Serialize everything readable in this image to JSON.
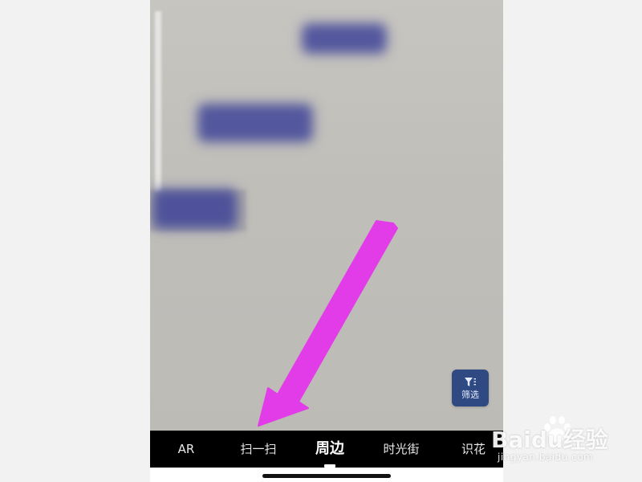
{
  "mode_bar": {
    "tabs": [
      {
        "label": "AR"
      },
      {
        "label": "扫一扫"
      },
      {
        "label": "周边"
      },
      {
        "label": "时光街"
      },
      {
        "label": "识花"
      }
    ],
    "active_tab": "周边"
  },
  "filter_button": {
    "label": "筛选",
    "icon": "filter-funnel-icon"
  },
  "watermark": {
    "logo_text": "Baidu经验",
    "url": "jingyan.baidu.com"
  },
  "annotation": {
    "color": "#e23ce8",
    "shape": "arrow"
  },
  "colors": {
    "mode_bar_bg": "#000000",
    "filter_button_bg": "#2f4a82",
    "poi_marker": "#3a4096",
    "viewfinder_bg": "#c2c0bb"
  }
}
